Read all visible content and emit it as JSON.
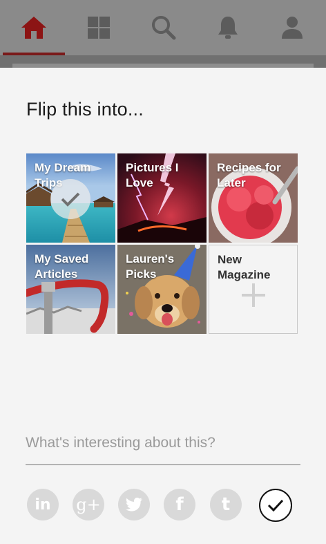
{
  "nav": {
    "items": [
      {
        "id": "home",
        "icon": "home-icon",
        "active": true
      },
      {
        "id": "grid",
        "icon": "grid-icon"
      },
      {
        "id": "search",
        "icon": "search-icon"
      },
      {
        "id": "notifications",
        "icon": "bell-icon"
      },
      {
        "id": "profile",
        "icon": "person-icon"
      }
    ],
    "active_color": "#b01e1e"
  },
  "sheet": {
    "title": "Flip this into...",
    "magazines": [
      {
        "label": "My Dream Trips",
        "selected": true
      },
      {
        "label": "Pictures I Love"
      },
      {
        "label": "Recipes for Later"
      },
      {
        "label": "My Saved Articles"
      },
      {
        "label": "Lauren's Picks"
      },
      {
        "label": "New Magazine",
        "icon": "plus-icon"
      }
    ],
    "comment_placeholder": "What's interesting about this?",
    "share_buttons": [
      {
        "id": "linkedin",
        "glyph": "in",
        "icon": "linkedin-icon"
      },
      {
        "id": "googleplus",
        "glyph": "g+",
        "icon": "google-plus-icon"
      },
      {
        "id": "twitter",
        "glyph": "",
        "icon": "twitter-icon"
      },
      {
        "id": "facebook",
        "glyph": "f",
        "icon": "facebook-icon"
      },
      {
        "id": "tumblr",
        "glyph": "t",
        "icon": "tumblr-icon"
      }
    ],
    "confirm_icon": "checkmark-icon"
  }
}
